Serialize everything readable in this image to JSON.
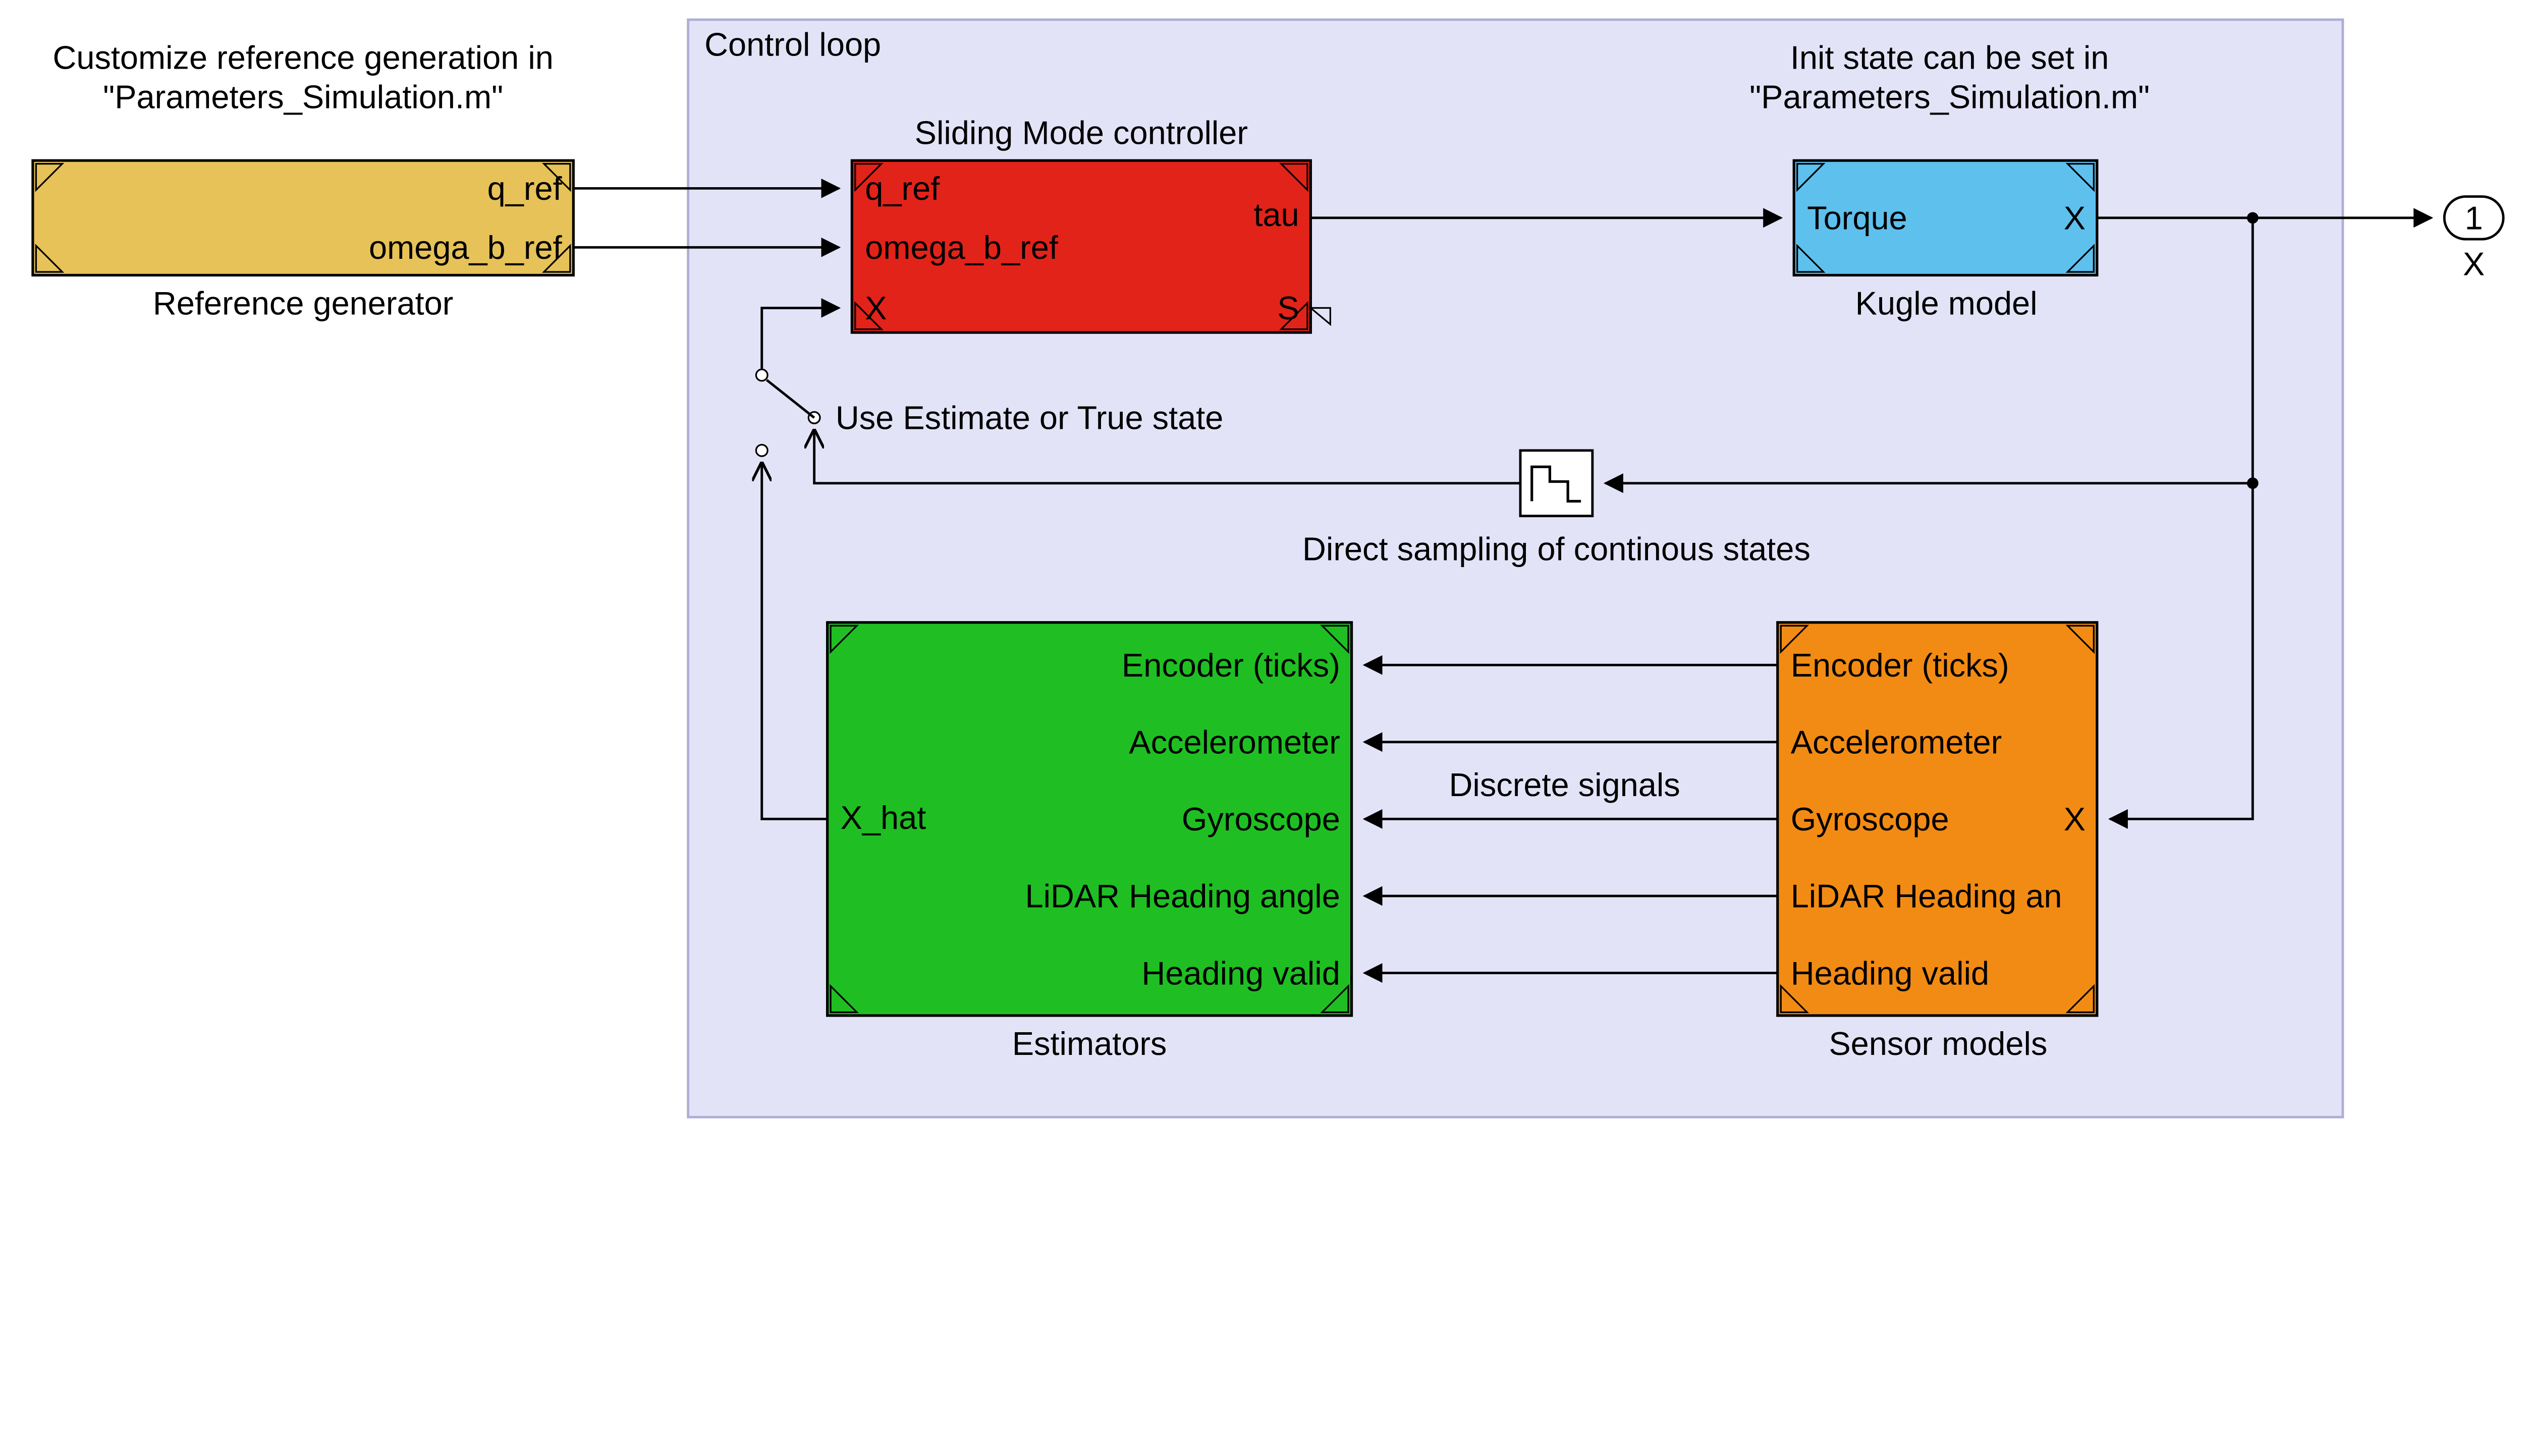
{
  "annotations": {
    "ref_gen_note_l1": "Customize reference generation in",
    "ref_gen_note_l2": "\"Parameters_Simulation.m\"",
    "init_state_note_l1": "Init state can be set in",
    "init_state_note_l2": "\"Parameters_Simulation.m\"",
    "switch_label": "Use Estimate or True state",
    "discrete_signals": "Discrete signals",
    "sampler_label": "Direct sampling of continous states"
  },
  "control_loop": {
    "title": "Control loop"
  },
  "blocks": {
    "ref_gen": {
      "title": "Reference generator",
      "ports": {
        "q_ref": "q_ref",
        "omega_b_ref": "omega_b_ref"
      }
    },
    "smc": {
      "title": "Sliding Mode controller",
      "ports": {
        "q_ref": "q_ref",
        "omega_b_ref": "omega_b_ref",
        "x": "X",
        "tau": "tau",
        "s": "S"
      }
    },
    "kugle": {
      "title": "Kugle model",
      "ports": {
        "torque": "Torque",
        "x": "X"
      }
    },
    "estimators": {
      "title": "Estimators",
      "ports": {
        "x_hat": "X_hat",
        "encoder": "Encoder (ticks)",
        "accel": "Accelerometer",
        "gyro": "Gyroscope",
        "lidar": "LiDAR Heading angle",
        "heading_valid": "Heading valid"
      }
    },
    "sensors": {
      "title": "Sensor models",
      "ports": {
        "x": "X",
        "encoder": "Encoder (ticks)",
        "accel": "Accelerometer",
        "gyro": "Gyroscope",
        "lidar_short": "LiDAR Heading an",
        "heading_valid": "Heading valid"
      }
    },
    "outport": {
      "num": "1",
      "name": "X"
    }
  },
  "colors": {
    "ref_gen": "#e6c258",
    "smc": "#e2231a",
    "kugle": "#5ec0ed",
    "estimator": "#1fbf23",
    "sensor": "#f28b14",
    "area": "#e3e3f8",
    "area_border": "#aeaed6"
  }
}
